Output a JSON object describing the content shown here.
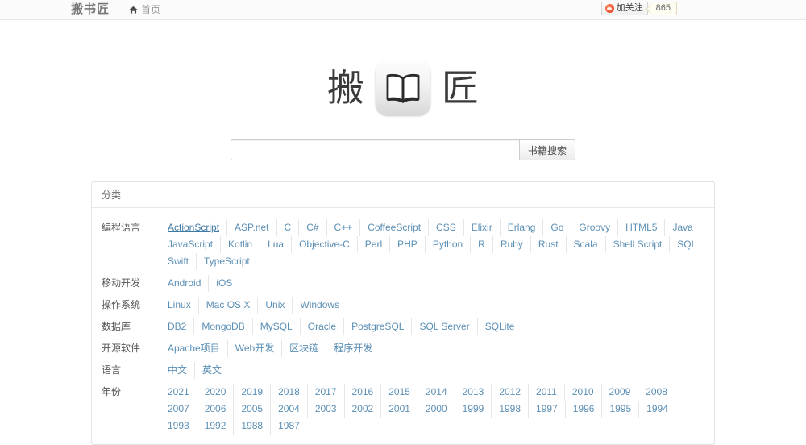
{
  "header": {
    "brand": "搬书匠",
    "home_label": "首页",
    "home_icon": "home-icon",
    "weibo": {
      "icon": "weibo-icon",
      "label": "加关注",
      "count": "865"
    }
  },
  "logo": {
    "left_char": "搬",
    "right_char": "匠",
    "icon": "open-book-icon"
  },
  "search": {
    "value": "",
    "placeholder": "",
    "button_label": "书籍搜索"
  },
  "panel": {
    "title": "分类",
    "rows": [
      {
        "label": "编程语言",
        "items": [
          {
            "text": "ActionScript",
            "active": true
          },
          {
            "text": "ASP.net"
          },
          {
            "text": "C"
          },
          {
            "text": "C#"
          },
          {
            "text": "C++"
          },
          {
            "text": "CoffeeScript"
          },
          {
            "text": "CSS"
          },
          {
            "text": "Elixir"
          },
          {
            "text": "Erlang"
          },
          {
            "text": "Go"
          },
          {
            "text": "Groovy"
          },
          {
            "text": "HTML5"
          },
          {
            "text": "Java"
          },
          {
            "text": "JavaScript"
          },
          {
            "text": "Kotlin"
          },
          {
            "text": "Lua"
          },
          {
            "text": "Objective-C"
          },
          {
            "text": "Perl"
          },
          {
            "text": "PHP"
          },
          {
            "text": "Python"
          },
          {
            "text": "R"
          },
          {
            "text": "Ruby"
          },
          {
            "text": "Rust"
          },
          {
            "text": "Scala"
          },
          {
            "text": "Shell Script"
          },
          {
            "text": "SQL"
          },
          {
            "text": "Swift"
          },
          {
            "text": "TypeScript"
          }
        ]
      },
      {
        "label": "移动开发",
        "items": [
          {
            "text": "Android"
          },
          {
            "text": "iOS"
          }
        ]
      },
      {
        "label": "操作系统",
        "items": [
          {
            "text": "Linux"
          },
          {
            "text": "Mac OS X"
          },
          {
            "text": "Unix"
          },
          {
            "text": "Windows"
          }
        ]
      },
      {
        "label": "数据库",
        "items": [
          {
            "text": "DB2"
          },
          {
            "text": "MongoDB"
          },
          {
            "text": "MySQL"
          },
          {
            "text": "Oracle"
          },
          {
            "text": "PostgreSQL"
          },
          {
            "text": "SQL Server"
          },
          {
            "text": "SQLite"
          }
        ]
      },
      {
        "label": "开源软件",
        "items": [
          {
            "text": "Apache项目"
          },
          {
            "text": "Web开发"
          },
          {
            "text": "区块链"
          },
          {
            "text": "程序开发"
          }
        ]
      },
      {
        "label": "语言",
        "items": [
          {
            "text": "中文"
          },
          {
            "text": "英文"
          }
        ]
      },
      {
        "label": "年份",
        "items": [
          {
            "text": "2021"
          },
          {
            "text": "2020"
          },
          {
            "text": "2019"
          },
          {
            "text": "2018"
          },
          {
            "text": "2017"
          },
          {
            "text": "2016"
          },
          {
            "text": "2015"
          },
          {
            "text": "2014"
          },
          {
            "text": "2013"
          },
          {
            "text": "2012"
          },
          {
            "text": "2011"
          },
          {
            "text": "2010"
          },
          {
            "text": "2009"
          },
          {
            "text": "2008"
          },
          {
            "text": "2007"
          },
          {
            "text": "2006"
          },
          {
            "text": "2005"
          },
          {
            "text": "2004"
          },
          {
            "text": "2003"
          },
          {
            "text": "2002"
          },
          {
            "text": "2001"
          },
          {
            "text": "2000"
          },
          {
            "text": "1999"
          },
          {
            "text": "1998"
          },
          {
            "text": "1997"
          },
          {
            "text": "1996"
          },
          {
            "text": "1995"
          },
          {
            "text": "1994"
          },
          {
            "text": "1993"
          },
          {
            "text": "1992"
          },
          {
            "text": "1988"
          },
          {
            "text": "1987"
          }
        ]
      }
    ]
  },
  "colors": {
    "link": "#5b8fb5",
    "link_active": "#3f7ba4",
    "navbar_bg": "#fbfbfb",
    "panel_border": "#e3e3e3",
    "weibo_accent": "#f2593a"
  }
}
